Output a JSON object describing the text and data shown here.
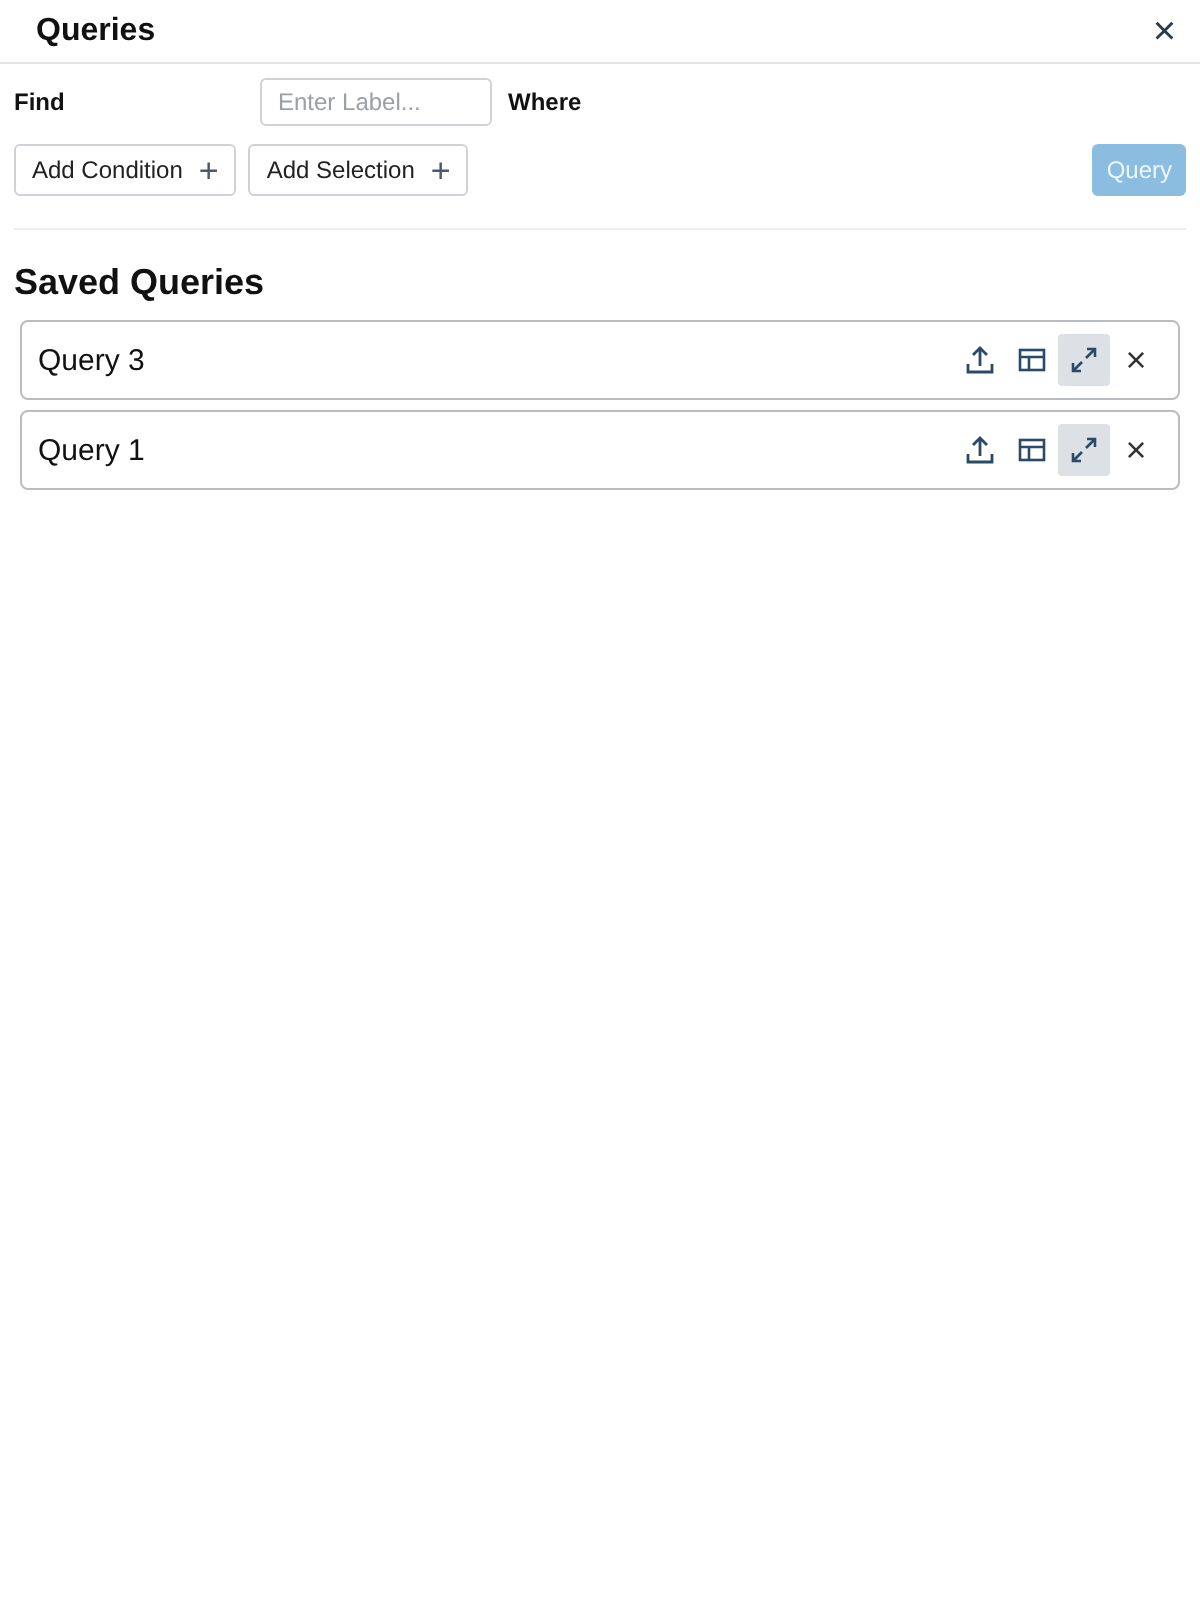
{
  "panel": {
    "title": "Queries",
    "close": "×"
  },
  "find": {
    "label": "Find",
    "placeholder": "Enter Label...",
    "where_label": "Where"
  },
  "actions": [
    {
      "label": "Add Condition",
      "icon": "+"
    },
    {
      "label": "Add Selection",
      "icon": "+"
    }
  ],
  "query_button": {
    "label": "Query",
    "disabled": true
  },
  "saved": {
    "heading": "Saved Queries",
    "items": [
      {
        "name": "Query 3",
        "remove": "×"
      },
      {
        "name": "Query 1",
        "remove": "×"
      }
    ]
  }
}
